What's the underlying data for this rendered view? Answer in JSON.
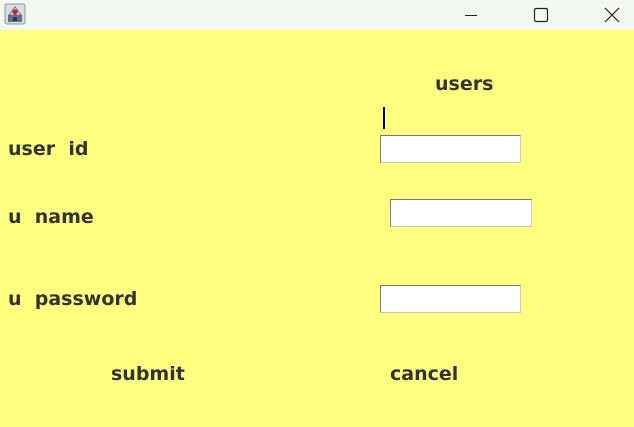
{
  "window": {
    "title": "",
    "icon": "java-app-icon",
    "controls": [
      "minimize-icon",
      "maximize-icon",
      "close-icon"
    ],
    "background_color": "#FFFF80"
  },
  "form": {
    "heading": "users",
    "fields": [
      {
        "label": "user  id",
        "value": ""
      },
      {
        "label": "u  name",
        "value": ""
      },
      {
        "label": "u  password",
        "value": ""
      }
    ],
    "submit_label": "submit",
    "cancel_label": "cancel"
  }
}
